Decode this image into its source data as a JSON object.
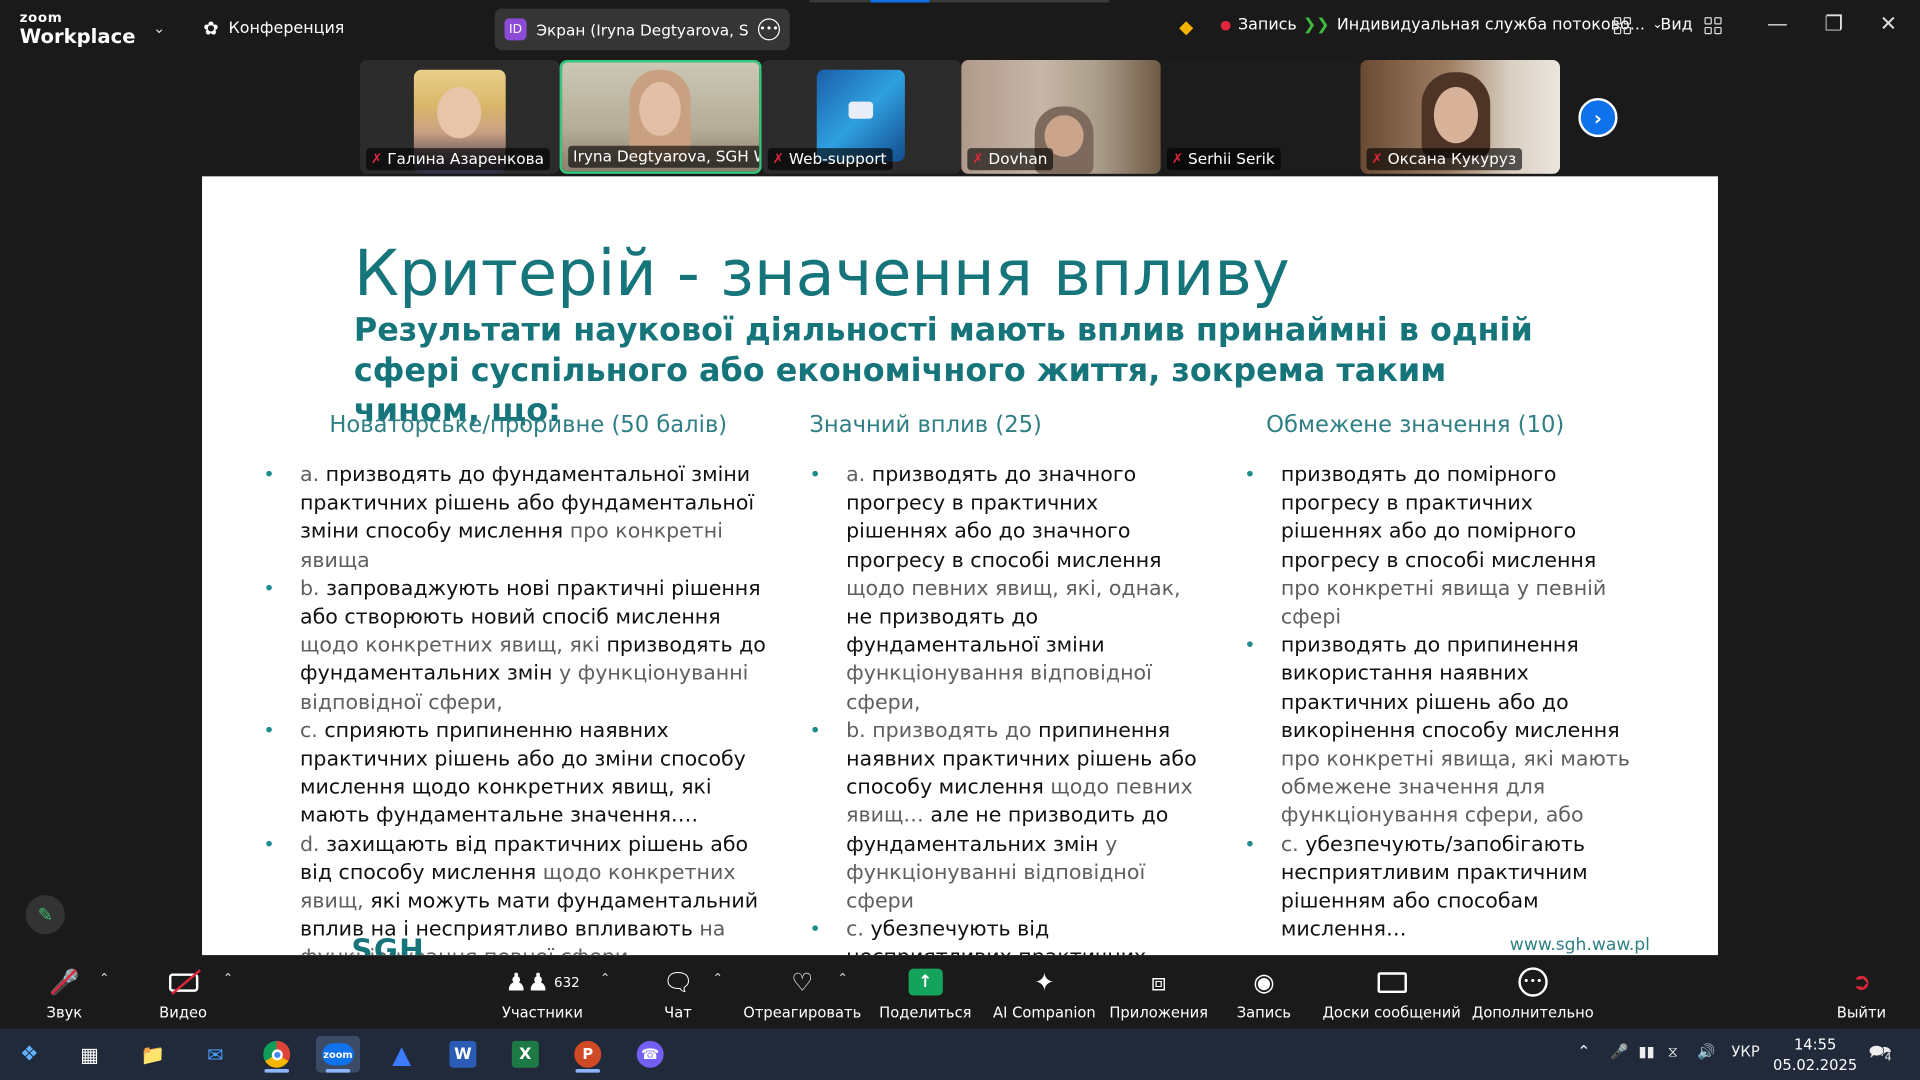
{
  "app": {
    "brand_small": "zoom",
    "brand_name": "Workplace"
  },
  "topbar": {
    "conference_label": "Конференция",
    "share_badge": "ID",
    "share_label": "Экран (Iryna Degtyarova, SGH W",
    "record_label": "Запись",
    "stream_label": "Индивидуальная служба потоково...",
    "view_label": "Вид"
  },
  "gallery": [
    {
      "name": "Галина Азаренкова",
      "muted": true,
      "active": false
    },
    {
      "name": "Iryna Degtyarova, SGH W...",
      "muted": false,
      "active": true
    },
    {
      "name": "Web-support",
      "muted": true,
      "active": false
    },
    {
      "name": "Dovhan",
      "muted": true,
      "active": false
    },
    {
      "name": "Serhii Serik",
      "muted": true,
      "active": false
    },
    {
      "name": "Оксана Кукуруз",
      "muted": true,
      "active": false
    }
  ],
  "slide": {
    "title": "Критерій - значення впливу",
    "subtitle": "Результати наукової діяльності мають вплив принаймні в одній сфері суспільного або економічного життя, зокрема таким чином, що:",
    "columns": [
      {
        "header": "Новаторське/проривне (50 балів)",
        "items": [
          [
            {
              "t": "a. ",
              "c": "g"
            },
            {
              "t": "призводять до фундаментальної зміни практичних рішень або фундаментальної зміни способу мислення",
              "c": "b"
            },
            {
              "t": " про конкретні явища",
              "c": "g"
            }
          ],
          [
            {
              "t": "b. ",
              "c": "g"
            },
            {
              "t": "запроваджують нові практичні рішення або створюють новий спосіб мислення",
              "c": "b"
            },
            {
              "t": " щодо конкретних явищ, які ",
              "c": "g"
            },
            {
              "t": "призводять до фундаментальних змін",
              "c": "b"
            },
            {
              "t": " у функціонуванні відповідної сфери,",
              "c": "g"
            }
          ],
          [
            {
              "t": "c. ",
              "c": "g"
            },
            {
              "t": "сприяють припиненню наявних практичних рішень або до зміни способу мислення щодо конкретних явищ, які мають фундаментальне значення….",
              "c": "b"
            }
          ],
          [
            {
              "t": "d. ",
              "c": "g"
            },
            {
              "t": "захищають від практичних рішень або від способу мислення",
              "c": "b"
            },
            {
              "t": " щодо конкретних явищ, ",
              "c": "g"
            },
            {
              "t": "які можуть мати фундаментальний вплив на і несприятливо впливають",
              "c": "b"
            },
            {
              "t": " на функціонування певної сфери.",
              "c": "g"
            }
          ]
        ]
      },
      {
        "header": "Значний вплив (25)",
        "items": [
          [
            {
              "t": "a. ",
              "c": "g"
            },
            {
              "t": "призводять до значного прогресу в практичних рішеннях або до значного прогресу в способі мислення",
              "c": "b"
            },
            {
              "t": " щодо певних явищ, які, однак, ",
              "c": "g"
            },
            {
              "t": "не призводять до фундаментальної зміни",
              "c": "b"
            },
            {
              "t": " функціонування відповідної сфери,",
              "c": "g"
            }
          ],
          [
            {
              "t": "b. призводять до ",
              "c": "g"
            },
            {
              "t": "припинення наявних практичних рішень або способу мислення",
              "c": "b"
            },
            {
              "t": " щодо певних явищ… ",
              "c": "g"
            },
            {
              "t": "але не призводить до фундаментальних змін",
              "c": "b"
            },
            {
              "t": " у функціонуванні відповідної сфери",
              "c": "g"
            }
          ],
          [
            {
              "t": "c. ",
              "c": "g"
            },
            {
              "t": "убезпечують від несприятливих практичних рішень або від способу мислення щодо певних явищ…",
              "c": "b"
            }
          ]
        ]
      },
      {
        "header": "Обмежене значення (10)",
        "items": [
          [
            {
              "t": "призводять до помірного прогресу в практичних рішеннях або до помірного прогресу в способі мислення",
              "c": "b"
            },
            {
              "t": " про конкретні явища у певній сфері",
              "c": "g"
            }
          ],
          [
            {
              "t": "призводять до припинення використання наявних практичних рішень або до викорінення способу мислення",
              "c": "b"
            },
            {
              "t": " про конкретні явища, які мають обмежене значення для функціонування сфери, або",
              "c": "g"
            }
          ],
          [
            {
              "t": "c. ",
              "c": "g"
            },
            {
              "t": "убезпечують/запобігають несприятливим практичним рішенням або способам мислення…",
              "c": "b"
            }
          ]
        ]
      }
    ],
    "footer_logo": "SGH",
    "footer_url": "www.sgh.waw.pl"
  },
  "toolbar": {
    "audio": "Звук",
    "video": "Видео",
    "participants": "Участники",
    "participants_count": "632",
    "chat": "Чат",
    "react": "Отреагировать",
    "share": "Поделиться",
    "ai": "AI Companion",
    "apps": "Приложения",
    "record": "Запись",
    "boards": "Доски сообщений",
    "more": "Дополнительно",
    "leave": "Выйти"
  },
  "taskbar": {
    "lang": "УКР",
    "time": "14:55",
    "date": "05.02.2025",
    "notif_count": "4"
  },
  "colors": {
    "accent": "#16757a",
    "zoom_blue": "#0e72ed",
    "record_red": "#e0263b",
    "active_border": "#34c77b"
  }
}
